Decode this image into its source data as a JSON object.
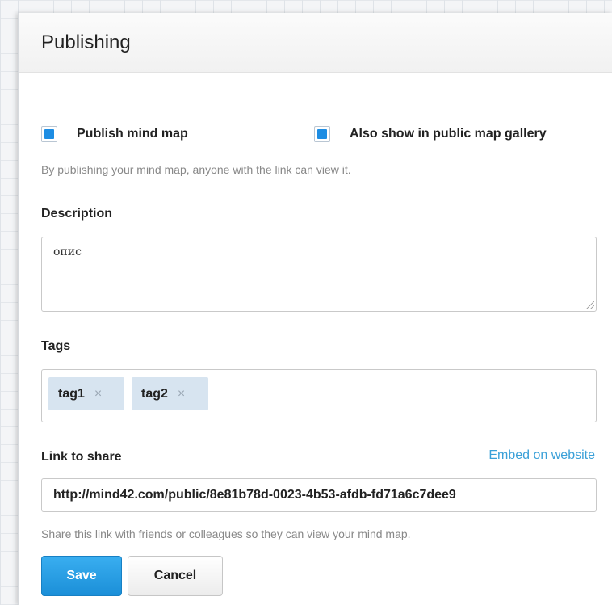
{
  "dialog": {
    "title": "Publishing"
  },
  "publish": {
    "publish_label": "Publish mind map",
    "publish_checked": true,
    "gallery_label": "Also show in public map gallery",
    "gallery_checked": true,
    "hint": "By publishing your mind map, anyone with the link can view it."
  },
  "description": {
    "label": "Description",
    "value": "опис"
  },
  "tags": {
    "label": "Tags",
    "items": [
      {
        "text": "tag1",
        "remove": "×"
      },
      {
        "text": "tag2",
        "remove": "×"
      }
    ]
  },
  "share": {
    "label": "Link to share",
    "embed_link": "Embed on website",
    "url": "http://mind42.com/public/8e81b78d-0023-4b53-afdb-fd71a6c7dee9",
    "hint": "Share this link with friends or colleagues so they can view your mind map."
  },
  "actions": {
    "save": "Save",
    "cancel": "Cancel"
  },
  "colors": {
    "accent": "#1d8de3",
    "link": "#3aa0d8",
    "tag_bg": "#d7e4f0"
  }
}
